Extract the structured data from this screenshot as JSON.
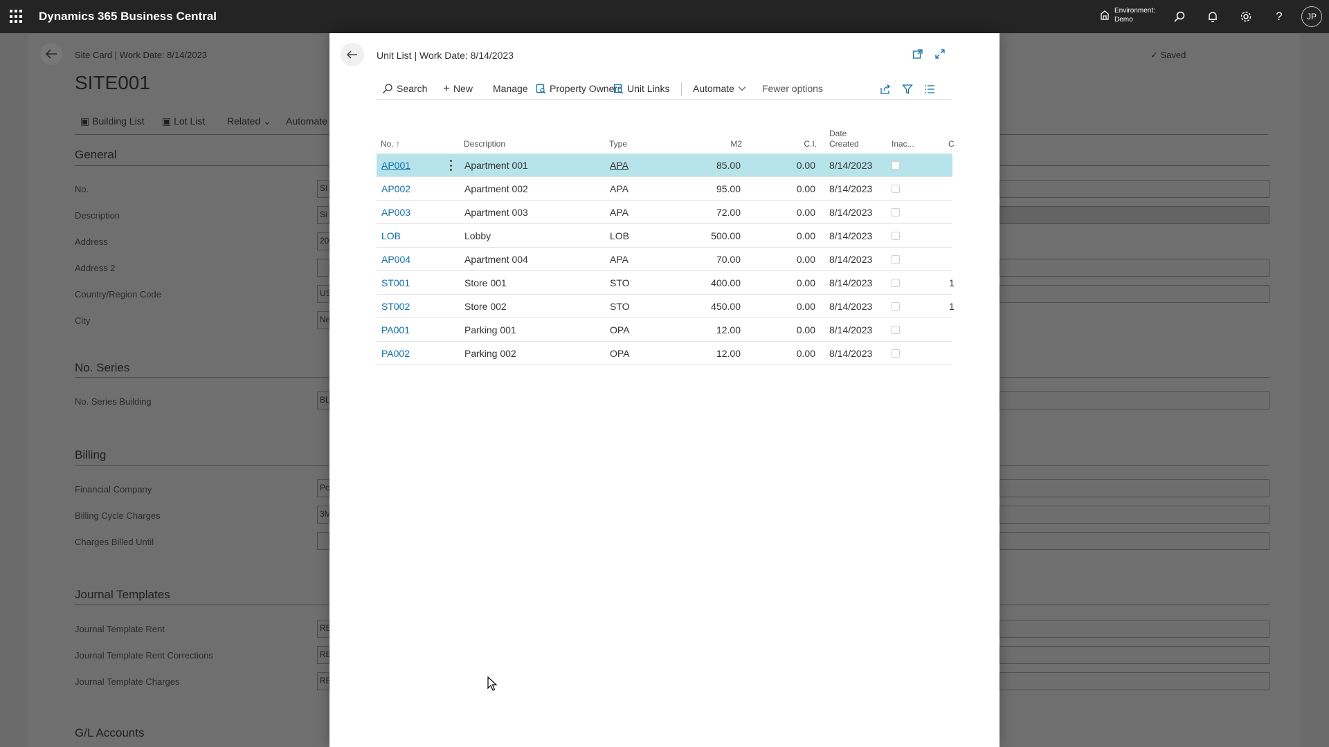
{
  "appbar": {
    "title": "Dynamics 365 Business Central",
    "env_label": "Environment:",
    "env_value": "Demo",
    "avatar": "JP",
    "icons": [
      "waffle-icon",
      "environment-icon",
      "search-icon",
      "bell-icon",
      "gear-icon",
      "help-icon"
    ]
  },
  "background": {
    "breadcrumb": "Site Card | Work Date: 8/14/2023",
    "saved": "Saved",
    "title": "SITE001",
    "actions": [
      "Building List",
      "Lot List",
      "Related",
      "Automate"
    ],
    "sections": {
      "general": {
        "heading": "General",
        "fields": [
          "No.",
          "Description",
          "Address",
          "Address 2",
          "Country/Region Code",
          "City"
        ],
        "values": [
          "SI",
          "Si",
          "20",
          "",
          "US",
          "Ne"
        ]
      },
      "no_series": {
        "heading": "No. Series",
        "fields": [
          "No. Series Building"
        ],
        "values": [
          "BL"
        ]
      },
      "billing": {
        "heading": "Billing",
        "fields": [
          "Financial Company",
          "Billing Cycle Charges",
          "Charges Billed Until"
        ],
        "values": [
          "Pc",
          "3M",
          ""
        ]
      },
      "journal": {
        "heading": "Journal Templates",
        "fields": [
          "Journal Template Rent",
          "Journal Template Rent Corrections",
          "Journal Template Charges"
        ],
        "values": [
          "RE",
          "RE",
          "RE"
        ]
      },
      "gl": {
        "heading": "G/L Accounts"
      }
    }
  },
  "modal": {
    "title": "Unit List | Work Date: 8/14/2023",
    "toolbar": {
      "search": "Search",
      "new": "New",
      "manage": "Manage",
      "property_owners": "Property Owners",
      "unit_links": "Unit Links",
      "automate": "Automate",
      "fewer_options": "Fewer options"
    },
    "columns": {
      "no": "No. ↑",
      "description": "Description",
      "type": "Type",
      "m2": "M2",
      "ci": "C.I.",
      "date_created_1": "Date",
      "date_created_2": "Created",
      "inactive": "Inac...",
      "more": "C"
    },
    "rows": [
      {
        "no": "AP001",
        "description": "Apartment 001",
        "type": "APA",
        "m2": "85.00",
        "ci": "0.00",
        "date": "8/14/2023",
        "extra": ""
      },
      {
        "no": "AP002",
        "description": "Apartment 002",
        "type": "APA",
        "m2": "95.00",
        "ci": "0.00",
        "date": "8/14/2023",
        "extra": ""
      },
      {
        "no": "AP003",
        "description": "Apartment 003",
        "type": "APA",
        "m2": "72.00",
        "ci": "0.00",
        "date": "8/14/2023",
        "extra": ""
      },
      {
        "no": "LOB",
        "description": "Lobby",
        "type": "LOB",
        "m2": "500.00",
        "ci": "0.00",
        "date": "8/14/2023",
        "extra": ""
      },
      {
        "no": "AP004",
        "description": "Apartment 004",
        "type": "APA",
        "m2": "70.00",
        "ci": "0.00",
        "date": "8/14/2023",
        "extra": ""
      },
      {
        "no": "ST001",
        "description": "Store 001",
        "type": "STO",
        "m2": "400.00",
        "ci": "0.00",
        "date": "8/14/2023",
        "extra": "1"
      },
      {
        "no": "ST002",
        "description": "Store 002",
        "type": "STO",
        "m2": "450.00",
        "ci": "0.00",
        "date": "8/14/2023",
        "extra": "1"
      },
      {
        "no": "PA001",
        "description": "Parking 001",
        "type": "OPA",
        "m2": "12.00",
        "ci": "0.00",
        "date": "8/14/2023",
        "extra": ""
      },
      {
        "no": "PA002",
        "description": "Parking 002",
        "type": "OPA",
        "m2": "12.00",
        "ci": "0.00",
        "date": "8/14/2023",
        "extra": ""
      }
    ]
  },
  "colors": {
    "appbar": "#242424",
    "link": "#0f6fa6",
    "selected_row": "#b7e4ea"
  }
}
